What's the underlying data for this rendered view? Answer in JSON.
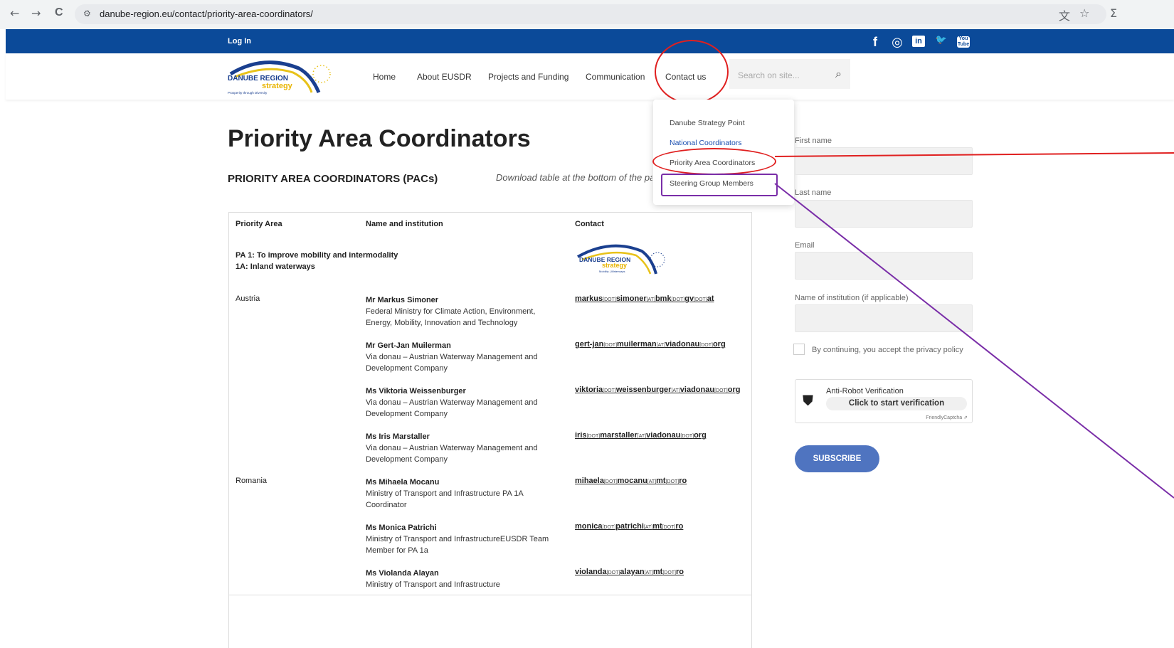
{
  "browser": {
    "back": "←",
    "forward": "→",
    "reload": "C",
    "site_icon": "⚙",
    "url": "danube-region.eu/contact/priority-area-coordinators/",
    "translate_icon": "文",
    "star_icon": "☆",
    "ext_icon": "Σ"
  },
  "topbar": {
    "login": "Log In",
    "social": {
      "facebook": "f",
      "instagram": "◎",
      "linkedin": "in",
      "twitter": "🐦",
      "youtube": "You Tube"
    }
  },
  "header": {
    "logo": {
      "line1": "DANUBE REGION",
      "line2": "strategy",
      "tagline": "Prosperity through Diversity"
    },
    "menu": [
      "Home",
      "About EUSDR",
      "Projects and Funding",
      "Communication",
      "Contact us"
    ],
    "search_placeholder": "Search on site...",
    "search_icon": "⌕"
  },
  "dropdown": {
    "items": [
      "Danube Strategy Point",
      "National Coordinators",
      "Priority Area Coordinators",
      "Steering Group Members"
    ]
  },
  "page": {
    "title": "Priority Area Coordinators",
    "subtitle": "PRIORITY AREA COORDINATORS (PACs)",
    "download_note": "Download table at the bottom of the page"
  },
  "table": {
    "headers": [
      "Priority Area",
      "Name and institution",
      "Contact"
    ],
    "pa_line1": "PA 1: To improve mobility and intermodality",
    "pa_line2": "1A: Inland waterways",
    "pa_logo": {
      "line1": "DANUBE REGION",
      "line2": "strategy",
      "tagline": "Mobility | Waterways"
    },
    "rows": [
      {
        "country": "Austria",
        "name": "Mr Markus Simoner",
        "inst": "Federal Ministry for Climate Action, Environment, Energy, Mobility, Innovation and Technology",
        "email": [
          [
            "markus",
            0
          ],
          [
            "[DOT]",
            1
          ],
          [
            "simoner",
            0
          ],
          [
            "[AT]",
            1
          ],
          [
            "bmk",
            0
          ],
          [
            "[DOT]",
            1
          ],
          [
            "gv",
            0
          ],
          [
            "[DOT]",
            1
          ],
          [
            "at",
            0
          ]
        ]
      },
      {
        "country": "",
        "name": "Mr Gert-Jan Muilerman",
        "inst": "Via donau – Austrian Waterway Management and Development Company",
        "email": [
          [
            "gert-jan",
            0
          ],
          [
            "[DOT]",
            1
          ],
          [
            "muilerman",
            0
          ],
          [
            "[AT]",
            1
          ],
          [
            "viadonau",
            0
          ],
          [
            "[DOT]",
            1
          ],
          [
            "org",
            0
          ]
        ]
      },
      {
        "country": "",
        "name": "Ms Viktoria Weissenburger",
        "inst": "Via donau – Austrian Waterway Management and Development Company",
        "email": [
          [
            "viktoria",
            0
          ],
          [
            "[DOT]",
            1
          ],
          [
            "weissenburger",
            0
          ],
          [
            "[AT]",
            1
          ],
          [
            "viadonau",
            0
          ],
          [
            "[DOT]",
            1
          ],
          [
            "org",
            0
          ]
        ]
      },
      {
        "country": "",
        "name": "Ms Iris Marstaller",
        "inst": "Via donau – Austrian Waterway Management and Development Company",
        "email": [
          [
            "iris",
            0
          ],
          [
            "[DOT]",
            1
          ],
          [
            "marstaller",
            0
          ],
          [
            "[AT]",
            1
          ],
          [
            "viadonau",
            0
          ],
          [
            "[DOT]",
            1
          ],
          [
            "org",
            0
          ]
        ]
      },
      {
        "country": "Romania",
        "name": "Ms Mihaela Mocanu",
        "inst": "Ministry of Transport and Infrastructure PA 1A Coordinator",
        "email": [
          [
            "mihaela",
            0
          ],
          [
            "[DOT]",
            1
          ],
          [
            "mocanu",
            0
          ],
          [
            "[AT]",
            1
          ],
          [
            "mt",
            0
          ],
          [
            "[DOT]",
            1
          ],
          [
            "ro",
            0
          ]
        ]
      },
      {
        "country": "",
        "name": "Ms Monica Patrichi",
        "inst": "Ministry of Transport and InfrastructureEUSDR Team Member for PA 1a",
        "email": [
          [
            "monica",
            0
          ],
          [
            "[DOT]",
            1
          ],
          [
            "patrichi",
            0
          ],
          [
            "[AT]",
            1
          ],
          [
            "mt",
            0
          ],
          [
            "[DOT]",
            1
          ],
          [
            "ro",
            0
          ]
        ]
      },
      {
        "country": "",
        "name": "Ms Violanda Alayan",
        "inst": "Ministry of Transport and Infrastructure",
        "email": [
          [
            "violanda",
            0
          ],
          [
            "[DOT]",
            1
          ],
          [
            "alayan",
            0
          ],
          [
            "[AT]",
            1
          ],
          [
            "mt",
            0
          ],
          [
            "[DOT]",
            1
          ],
          [
            "ro",
            0
          ]
        ]
      }
    ]
  },
  "form": {
    "first_name": "First name",
    "last_name": "Last name",
    "email": "Email",
    "institution": "Name of institution (if applicable)",
    "consent": "By continuing, you accept the privacy policy",
    "captcha_title": "Anti-Robot Verification",
    "captcha_button": "Click to start verification",
    "captcha_brand": "FriendlyCaptcha ⇗",
    "subscribe": "SUBSCRIBE"
  },
  "colors": {
    "topbar": "#0b4a99",
    "logo_blue": "#1a3f8f",
    "logo_yellow": "#e8c21a",
    "annotation_red": "#e02020",
    "annotation_purple": "#7a2ea8",
    "subscribe": "#4f74c0"
  }
}
